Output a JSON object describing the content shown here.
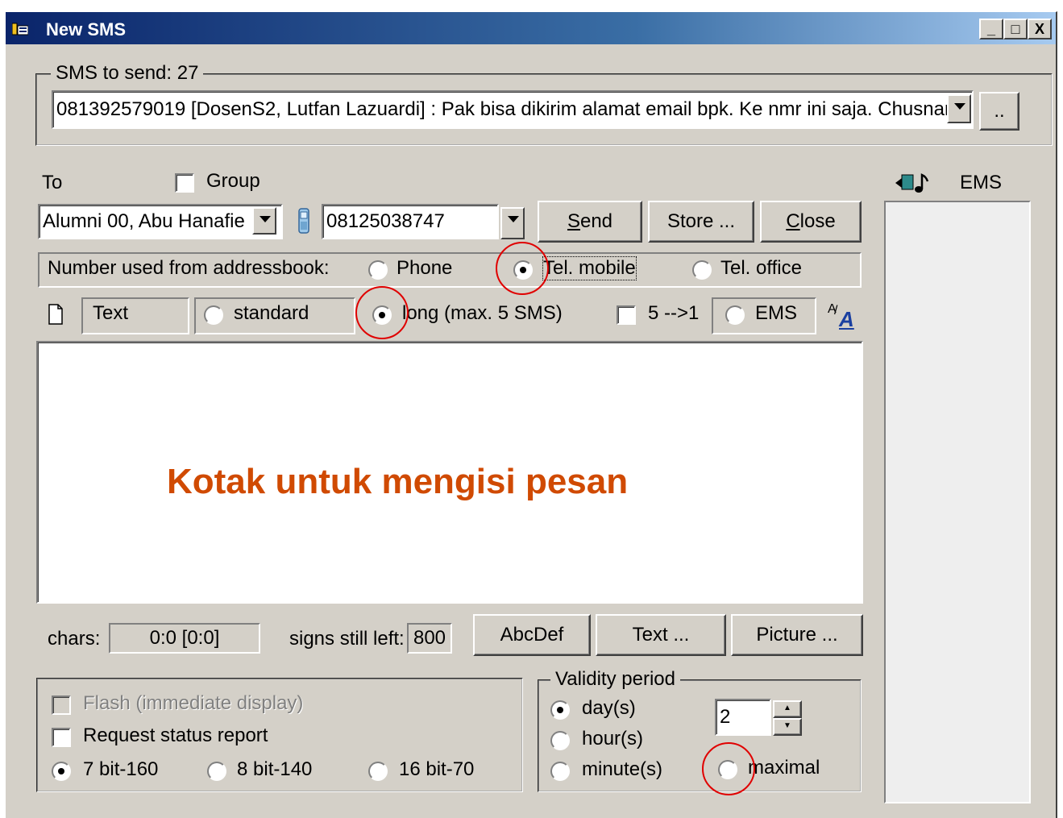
{
  "window": {
    "title": "New SMS",
    "btn_minimize": "_",
    "btn_maximize": "□",
    "btn_close": "X"
  },
  "sms_group": {
    "title": "SMS to send: 27",
    "selected": "081392579019 [DosenS2, Lutfan Lazuardi] : Pak bisa dikirim alamat email bpk. Ke nmr ini saja. Chusnan",
    "browse_label": ".."
  },
  "recipient": {
    "to_label": "To",
    "group_label": "Group",
    "contact": "Alumni 00, Abu Hanafie",
    "number": "08125038747",
    "send_label": "Send",
    "store_label": "Store ...",
    "close_label": "Close"
  },
  "addressbook": {
    "label": "Number used from addressbook:",
    "options": [
      "Phone",
      "Tel. mobile",
      "Tel. office"
    ],
    "selected": "Tel. mobile"
  },
  "format": {
    "text_label": "Text",
    "standard_label": "standard",
    "long_label": "long  (max. 5 SMS)",
    "selected": "long  (max. 5 SMS)",
    "combine_label": "5 -->1",
    "ems_label": "EMS",
    "font_icon_text": "A"
  },
  "message": {
    "annotation": "Kotak untuk mengisi pesan",
    "annotation_color": "#d04a02"
  },
  "counters": {
    "chars_label": "chars:",
    "chars_value": "0:0 [0:0]",
    "signs_label": "signs still left:",
    "signs_value": "800",
    "abcdef_label": "AbcDef",
    "text_button": "Text ...",
    "picture_button": "Picture ..."
  },
  "options": {
    "flash_label": "Flash (immediate display)",
    "status_report_label": "Request status report",
    "encodings": [
      "7 bit-160",
      "8 bit-140",
      "16 bit-70"
    ],
    "encoding_selected": "7 bit-160"
  },
  "validity": {
    "title": "Validity period",
    "units": [
      "day(s)",
      "hour(s)",
      "minute(s)"
    ],
    "unit_selected": "day(s)",
    "value": "2",
    "maximal_label": "maximal"
  },
  "ems_panel": {
    "title": "EMS"
  },
  "colors": {
    "highlight_circle": "#e00000",
    "titlebar_start": "#0a246a"
  }
}
